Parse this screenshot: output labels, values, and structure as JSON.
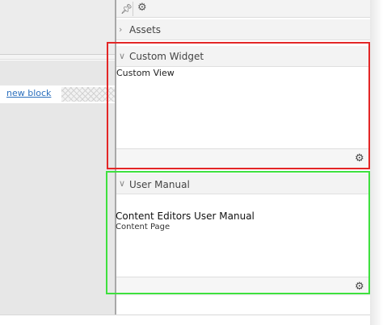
{
  "workspace": {
    "add_block_link": "new block"
  },
  "panel": {
    "toolbar": {
      "pin_icon": "pin-icon",
      "settings_icon": "gear-icon"
    },
    "sections": {
      "assets": {
        "title": "Assets",
        "state": "collapsed"
      },
      "custom_widget": {
        "title": "Custom Widget",
        "state": "expanded",
        "content": "Custom View"
      },
      "user_manual": {
        "title": "User Manual",
        "state": "expanded",
        "content_title": "Content Editors User Manual",
        "content_subtitle": "Content Page"
      }
    }
  },
  "highlights": {
    "custom_widget_color": "#e32626",
    "user_manual_color": "#3ee03e"
  },
  "colors": {
    "link": "#2b6fbd",
    "panel_header": "#f3f3f3"
  }
}
